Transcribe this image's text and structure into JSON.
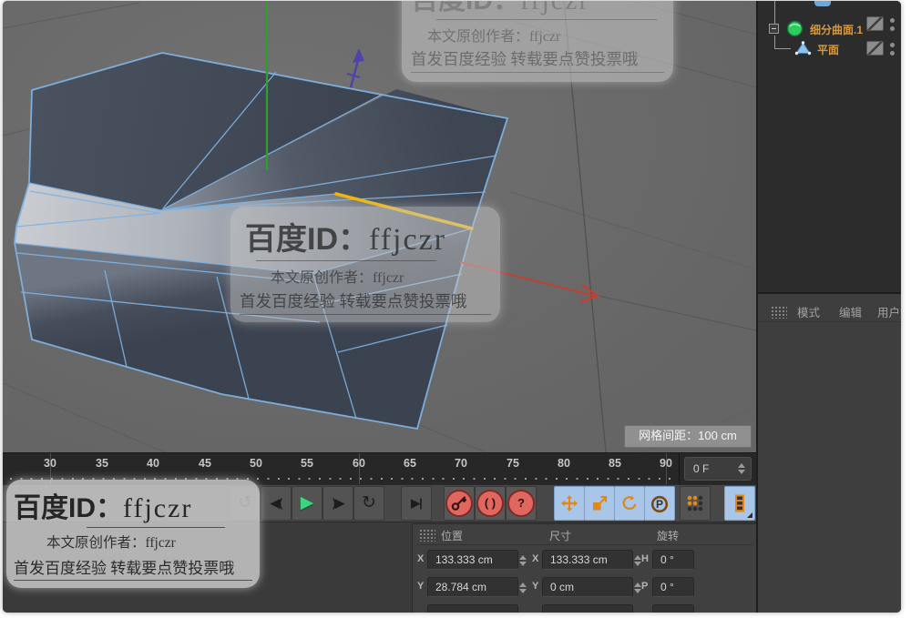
{
  "viewport": {
    "grid_spacing_label": "网格间距：100 cm"
  },
  "watermark": {
    "title_prefix": "百度ID：",
    "title_id": "ffjczr",
    "author_line": "本文原创作者：ffjczr",
    "footer_line": "首发百度经验 转载要点赞投票哦"
  },
  "object_manager": {
    "objects": [
      {
        "name": "细分曲面.1",
        "icon": "subdivision-surface-icon"
      },
      {
        "name": "平面",
        "icon": "plane-icon"
      }
    ]
  },
  "attribute_manager": {
    "tabs": [
      {
        "label": "模式"
      },
      {
        "label": "编辑"
      },
      {
        "label": "用户数据"
      }
    ]
  },
  "timeline": {
    "tick_labels": [
      "30",
      "35",
      "40",
      "45",
      "50",
      "55",
      "60",
      "65",
      "70",
      "75",
      "80",
      "85",
      "90"
    ],
    "current_frame": "0 F"
  },
  "transport": {
    "goto_start_glyph": "↺",
    "prev_key_glyph": "◀(",
    "play_glyph": "▶",
    "next_key_glyph": ")▶",
    "goto_end_glyph": "↻",
    "play_to_end_glyph": "▶|",
    "autokey_glyph": "( )",
    "help_glyph": "?",
    "p_glyph": "P"
  },
  "coordinates": {
    "section_position": "位置",
    "section_size": "尺寸",
    "section_rotation": "旋转",
    "rows": [
      {
        "pos_axis": "X",
        "pos_value": "133.333 cm",
        "size_axis": "X",
        "size_value": "133.333 cm",
        "rot_axis": "H",
        "rot_value": "0 °"
      },
      {
        "pos_axis": "Y",
        "pos_value": "28.784 cm",
        "size_axis": "Y",
        "size_value": "0 cm",
        "rot_axis": "P",
        "rot_value": "0 °"
      }
    ]
  },
  "colors": {
    "wireframe": "#7fb2e2",
    "highlight_edge": "#f2b705",
    "axis_x": "#c23f33",
    "axis_y": "#2f9e2f",
    "axis_z": "#4d43a8",
    "selected_text": "#d9993b",
    "tool_active_bg": "#a9c6e8",
    "tool_icon": "#e0881a",
    "record_red": "#e0675f"
  }
}
